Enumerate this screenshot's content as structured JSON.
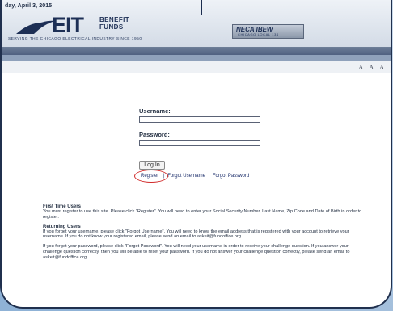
{
  "header": {
    "date": "day, April 3, 2015",
    "logo_main": "EIT",
    "logo_benefit_line1": "BENEFIT",
    "logo_benefit_line2": "FUNDS",
    "logo_tagline": "SERVING THE CHICAGO ELECTRICAL INDUSTRY SINCE 1950",
    "neca_logo": "NECA IBEW",
    "neca_sub": "CHICAGO  LOCAL 134"
  },
  "toolbar": {
    "text_size_label": "A A A"
  },
  "login": {
    "username_label": "Username:",
    "password_label": "Password:",
    "login_button": "Log In",
    "register_link": "Register",
    "separator": "|",
    "forgot_username_link": "Forgot Username",
    "forgot_password_link": "Forgot Password"
  },
  "info": {
    "first_time_heading": "First Time Users",
    "first_time_text": "You must register to use this site. Please click \"Register\". You will need to enter your Social Security Number, Last Name, Zip Code and Date of Birth in order to register.",
    "returning_heading": "Returning Users",
    "returning_text": "If you forget your username, please click \"Forgot Username\". You will need to know the email address that is registered with your account to retrieve your username. If you do not know your registered email, please send an email to askeit@fundoffice.org.",
    "password_text": "If you forget your password, please click \"Forgot Password\". You will need your username in order to receive your challenge question. If you answer your challenge question correctly, then you will be able to reset your password. If you do not answer your challenge question correctly, please send an email to askeit@fundoffice.org."
  },
  "colors": {
    "frame": "#20304e",
    "brand_navy": "#1d2f55",
    "highlight_circle": "#d12a2a"
  }
}
